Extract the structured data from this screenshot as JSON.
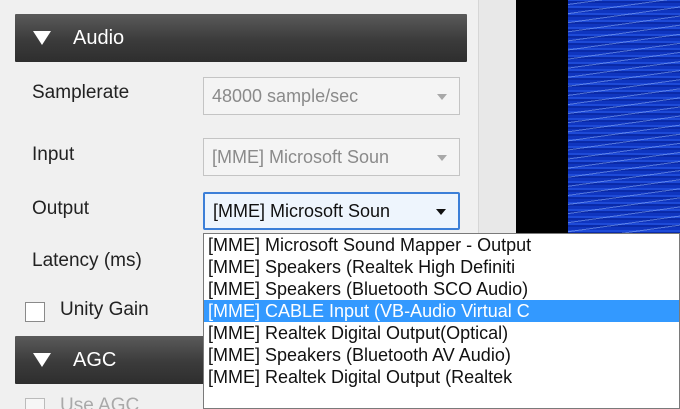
{
  "audio_section": {
    "title": "Audio",
    "samplerate": {
      "label": "Samplerate",
      "value": "48000 sample/sec"
    },
    "input": {
      "label": "Input",
      "value": "[MME] Microsoft Soun"
    },
    "output": {
      "label": "Output",
      "value": "[MME] Microsoft Soun",
      "options": [
        "[MME] Microsoft Sound Mapper - Output",
        "[MME] Speakers (Realtek High Definiti",
        "[MME] Speakers (Bluetooth SCO Audio)",
        "[MME] CABLE Input (VB-Audio Virtual C",
        "[MME] Realtek Digital Output(Optical)",
        "[MME] Speakers (Bluetooth AV Audio)",
        "[MME] Realtek Digital Output (Realtek"
      ],
      "highlighted_index": 3
    },
    "latency": {
      "label": "Latency (ms)"
    },
    "unity_gain": {
      "label": "Unity Gain",
      "checked": false
    }
  },
  "agc_section": {
    "title": "AGC",
    "use_agc": {
      "label": "Use AGC",
      "checked": false
    }
  },
  "colors": {
    "header_bg": "#3b3b3b",
    "selection": "#3399ff",
    "waterfall": "#1438c8"
  }
}
